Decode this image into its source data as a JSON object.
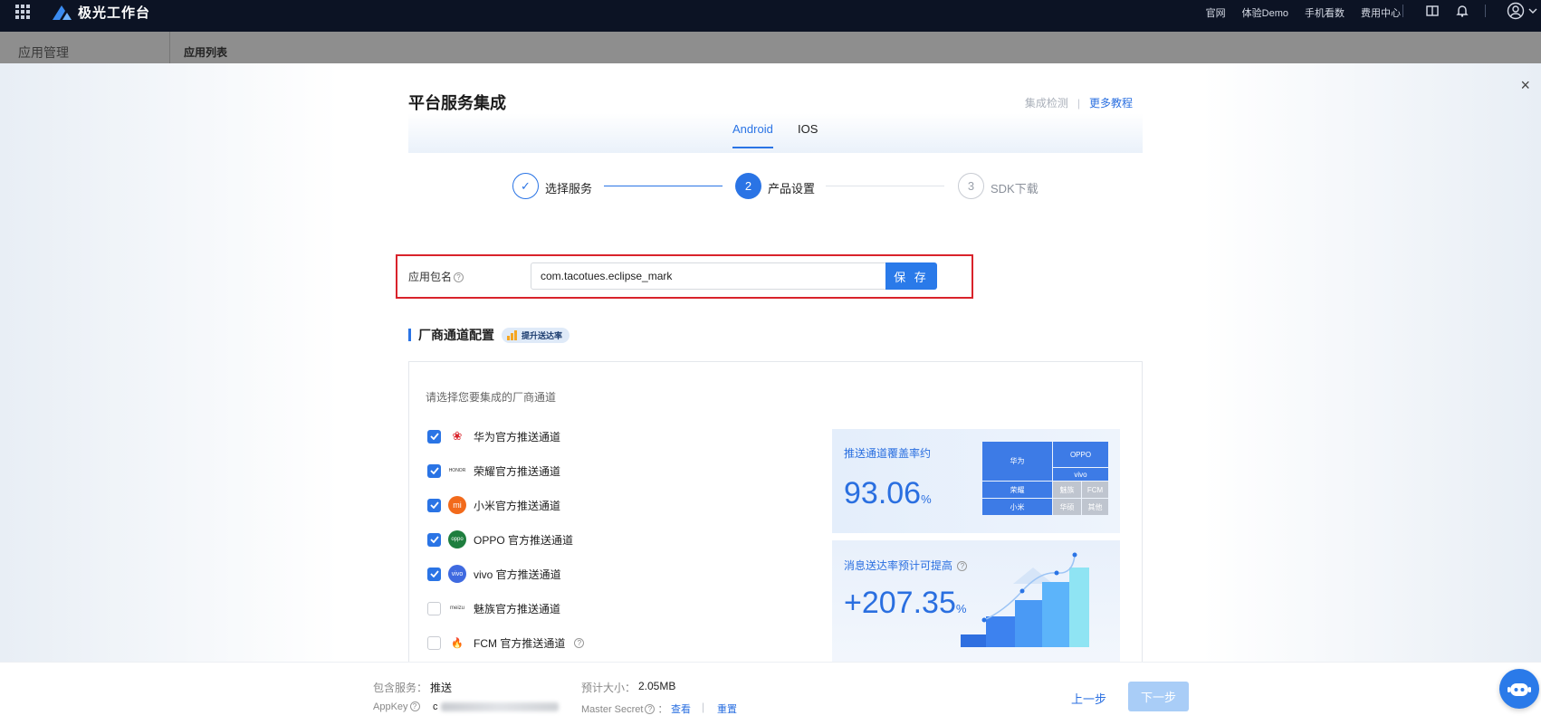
{
  "topnav": {
    "brand": "极光工作台",
    "links": [
      "官网",
      "体验Demo",
      "手机看数",
      "费用中心"
    ]
  },
  "subbar": {
    "app_manage": "应用管理",
    "app_list": "应用列表"
  },
  "modal": {
    "title": "平台服务集成",
    "check_link": "集成检测",
    "divider": "|",
    "tutorial_link": "更多教程",
    "close": "×",
    "tabs": [
      "Android",
      "IOS"
    ],
    "steps": [
      {
        "num": "✓",
        "label": "选择服务",
        "state": "done"
      },
      {
        "num": "2",
        "label": "产品设置",
        "state": "active"
      },
      {
        "num": "3",
        "label": "SDK下载",
        "state": "pending"
      }
    ],
    "package": {
      "label": "应用包名",
      "value": "com.tacotues.eclipse_mark",
      "save": "保 存"
    },
    "vendor_section": {
      "title": "厂商通道配置",
      "badge": "提升送达率",
      "prompt": "请选择您要集成的厂商通道",
      "vendors": [
        {
          "label": "华为官方推送通道",
          "checked": true,
          "icon": "huawei-logo-icon",
          "color": "#d9232b",
          "mark": "❀"
        },
        {
          "label": "荣耀官方推送通道",
          "checked": true,
          "icon": "honor-logo-icon",
          "color": "#ffffff",
          "mark": "HONOR"
        },
        {
          "label": "小米官方推送通道",
          "checked": true,
          "icon": "xiaomi-logo-icon",
          "color": "#f26a1b",
          "mark": "mi"
        },
        {
          "label": "OPPO 官方推送通道",
          "checked": true,
          "icon": "oppo-logo-icon",
          "color": "#1e7e3e",
          "mark": "oppo"
        },
        {
          "label": "vivo 官方推送通道",
          "checked": true,
          "icon": "vivo-logo-icon",
          "color": "#3f6ae0",
          "mark": "vivo"
        },
        {
          "label": "魅族官方推送通道",
          "checked": false,
          "icon": "meizu-logo-icon",
          "color": "#ffffff",
          "mark": "meizu"
        },
        {
          "label": "FCM 官方推送通道",
          "checked": false,
          "icon": "fcm-logo-icon",
          "color": "#ffffff",
          "mark": "🔥",
          "help": true
        }
      ]
    },
    "coverage": {
      "label": "推送通道覆盖率约",
      "value": "93.06",
      "unit": "%",
      "treemap": [
        "华为",
        "OPPO",
        "vivo",
        "荣耀",
        "魅族",
        "FCM",
        "小米",
        "华硕",
        "其他"
      ]
    },
    "improvement": {
      "label": "消息送达率预计可提高",
      "value": "+207.35",
      "unit": "%"
    }
  },
  "footer": {
    "services_label": "包含服务：",
    "services_value": "推送",
    "size_label": "预计大小：",
    "size_value": "2.05MB",
    "appkey_label": "AppKey",
    "appkey_prefix": "c",
    "secret_label": "Master Secret",
    "view_link": "查看",
    "sep": "|",
    "reset_link": "重置",
    "prev_btn": "上一步",
    "next_btn": "下一步"
  }
}
